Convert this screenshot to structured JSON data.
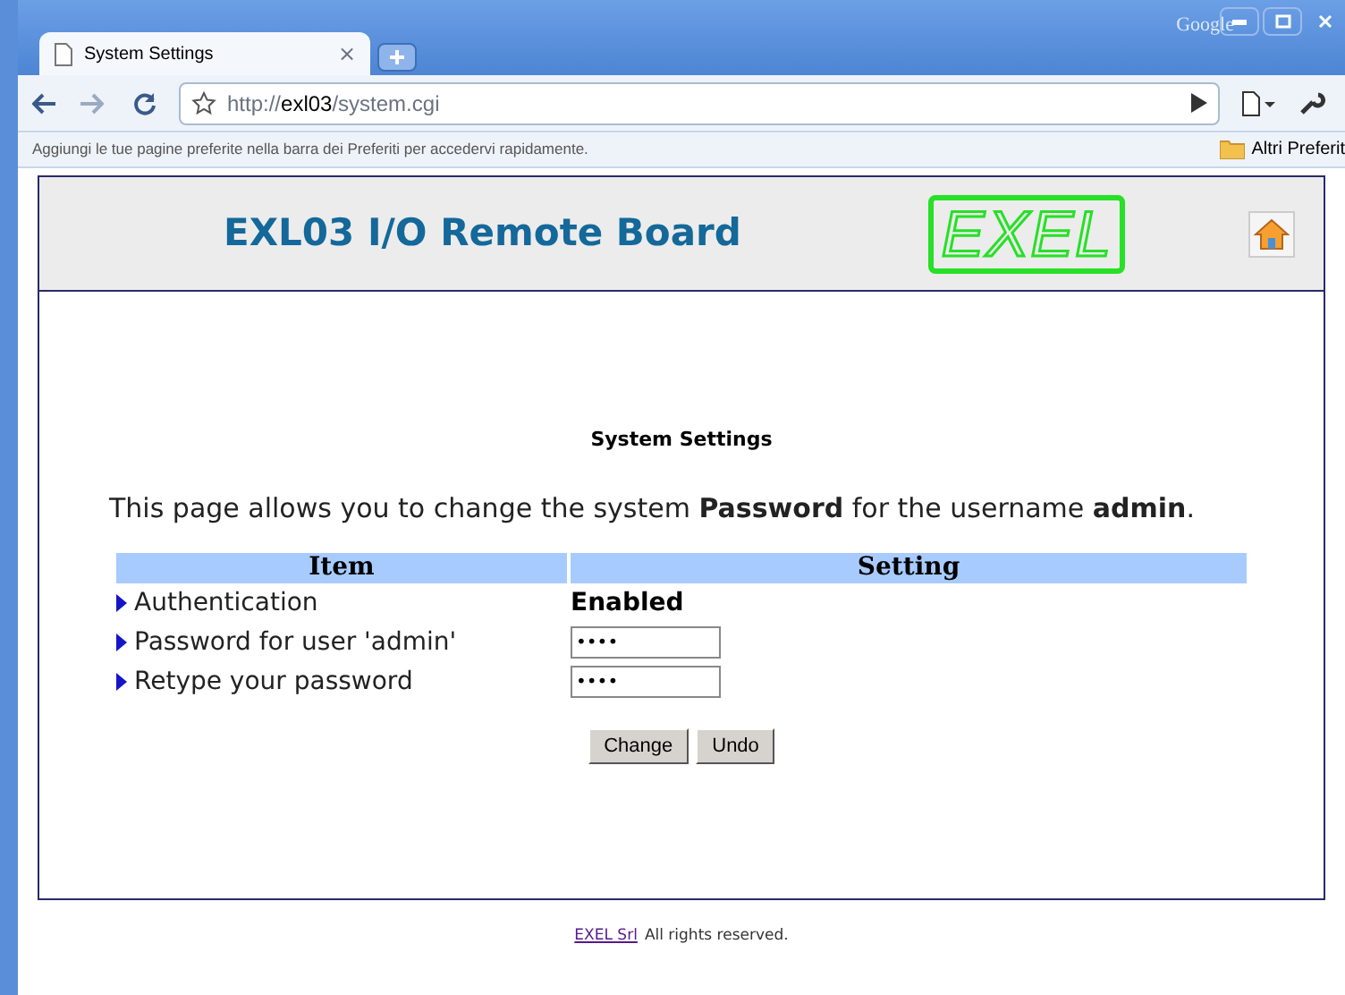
{
  "browser": {
    "brand": "Google",
    "tab": {
      "title": "System Settings",
      "close": "×"
    },
    "url": {
      "scheme": "http://",
      "host": "exl03",
      "path": "/system.cgi"
    },
    "bookmarks_hint": "Aggiungi le tue pagine preferite nella barra dei Preferiti per accedervi rapidamente.",
    "other_bookmarks": "Altri Preferit"
  },
  "header": {
    "title": "EXL03 I/O Remote Board",
    "logo": "EXEL"
  },
  "page": {
    "heading": "System Settings",
    "description": "This page allows you to change the system **Password** for the username **admin**.",
    "table": {
      "columns": [
        "Item",
        "Setting"
      ],
      "rows": [
        {
          "label": "Authentication",
          "kind": "text",
          "value": "Enabled"
        },
        {
          "label": "Password for user 'admin'",
          "kind": "input",
          "value": "••••"
        },
        {
          "label": "Retype your password",
          "kind": "input",
          "value": "••••"
        }
      ]
    },
    "buttons": [
      "Change",
      "Undo"
    ]
  },
  "footer": {
    "link": "EXEL Srl",
    "text": "All rights reserved."
  }
}
